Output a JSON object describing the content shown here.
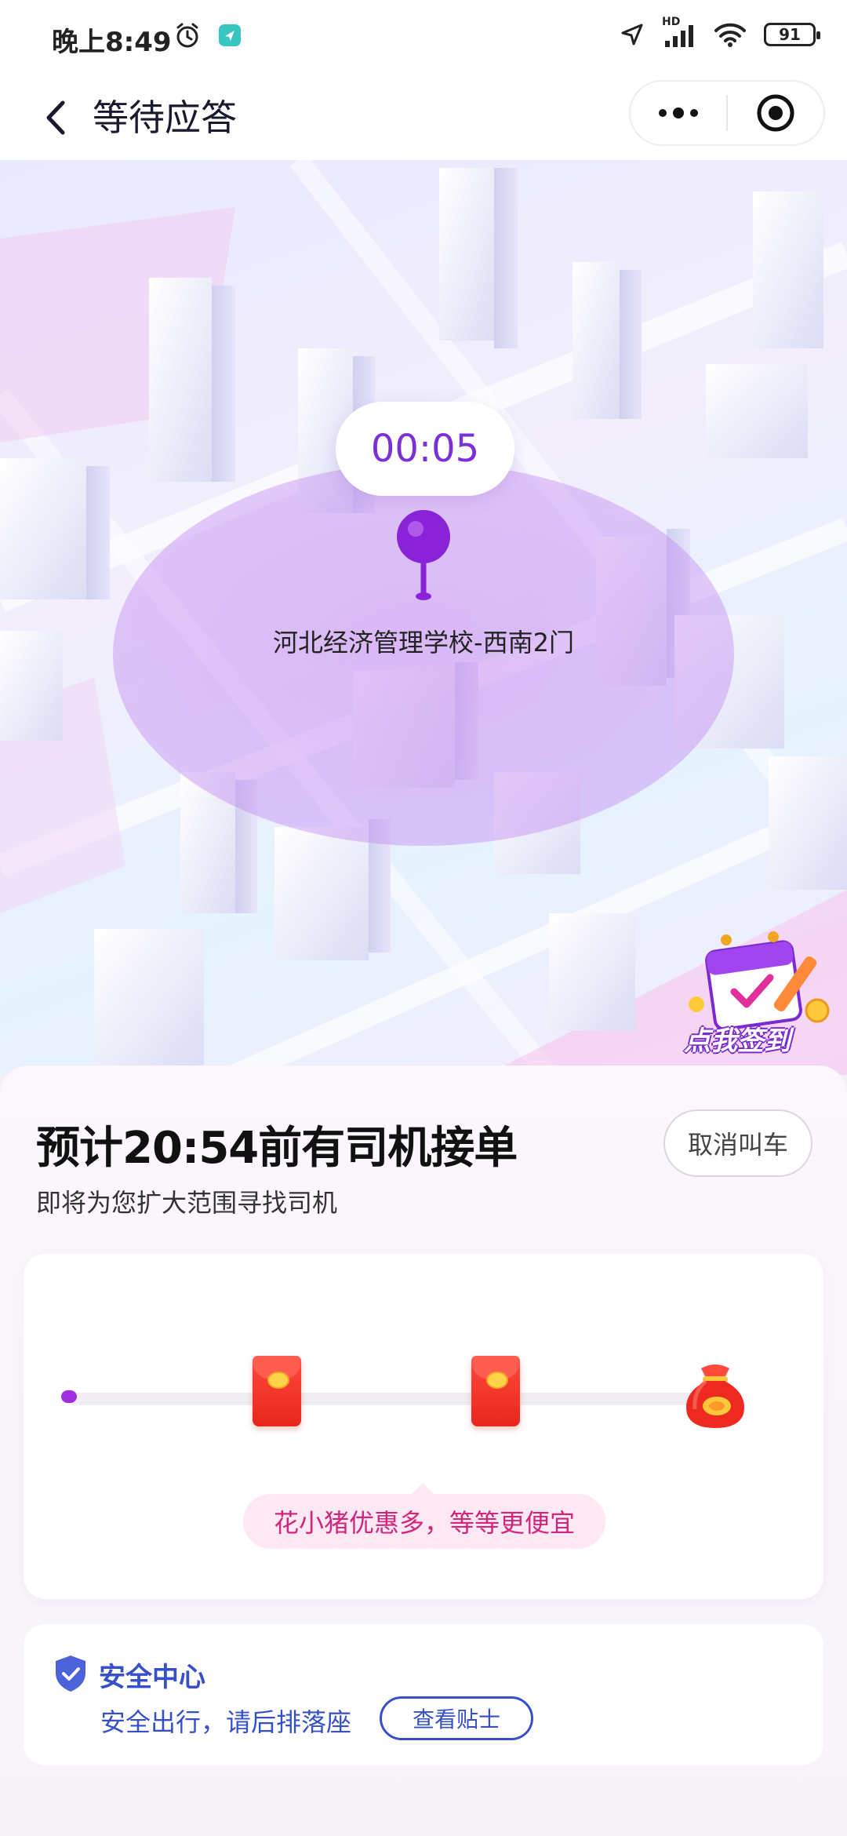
{
  "status_bar": {
    "time": "晚上8:49",
    "network": "HD",
    "battery": "91"
  },
  "nav": {
    "title": "等待应答"
  },
  "map": {
    "timer": "00:05",
    "pickup_point": "河北经济管理学校-西南2门",
    "checkin_label": "点我签到"
  },
  "order": {
    "eta_title": "预计20:54前有司机接单",
    "eta_subtitle": "即将为您扩大范围寻找司机",
    "cancel_label": "取消叫车"
  },
  "rewards": {
    "hint": "花小猪优惠多，等等更便宜"
  },
  "safety": {
    "title": "安全中心",
    "description": "安全出行，请后排落座",
    "tips_label": "查看贴士"
  },
  "colors": {
    "accent_purple": "#7b2fd6",
    "safety_blue": "#3550c8",
    "hint_pink": "#d1267c"
  }
}
